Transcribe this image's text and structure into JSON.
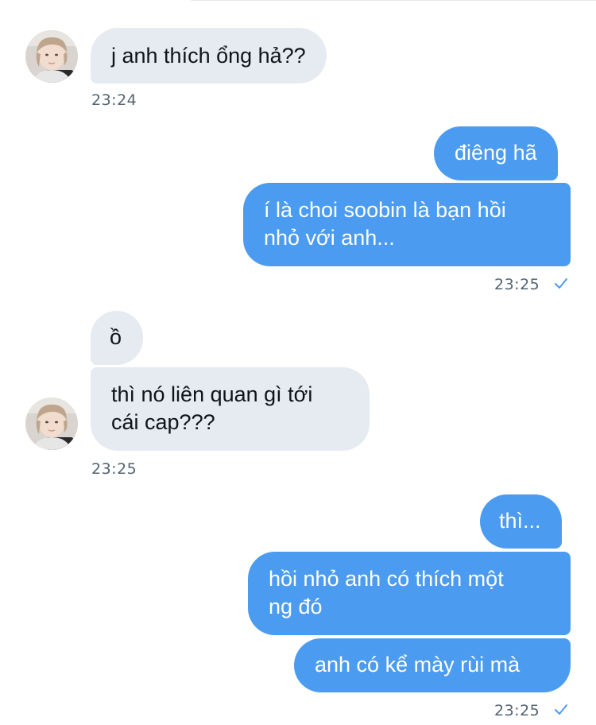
{
  "messages": [
    {
      "sender": "contact",
      "text": "j anh thích ổng hả??"
    },
    {
      "sender": "me",
      "text": "điêng hã"
    },
    {
      "sender": "me",
      "line1": "í là choi soobin là bạn hồi",
      "line2": "nhỏ với anh..."
    },
    {
      "sender": "contact",
      "text": "ồ"
    },
    {
      "sender": "contact",
      "line1": "thì nó liên quan gì tới",
      "line2": "cái cap???"
    },
    {
      "sender": "me",
      "text": "thì..."
    },
    {
      "sender": "me",
      "line1": "hồi nhỏ anh có thích một",
      "line2": "ng đó"
    },
    {
      "sender": "me",
      "text": "anh có kể mày rùi mà"
    }
  ],
  "timestamps": {
    "t1": "23:24",
    "t2": "23:25",
    "t3": "23:25",
    "t4": "23:25"
  },
  "colors": {
    "incoming_bubble": "#e6ebf1",
    "outgoing_bubble": "#4b9cf0",
    "timestamp_text": "#536471",
    "read_check": "#4b9cf0"
  },
  "icons": {
    "read_receipt": "check-icon",
    "contact_avatar": "avatar"
  }
}
